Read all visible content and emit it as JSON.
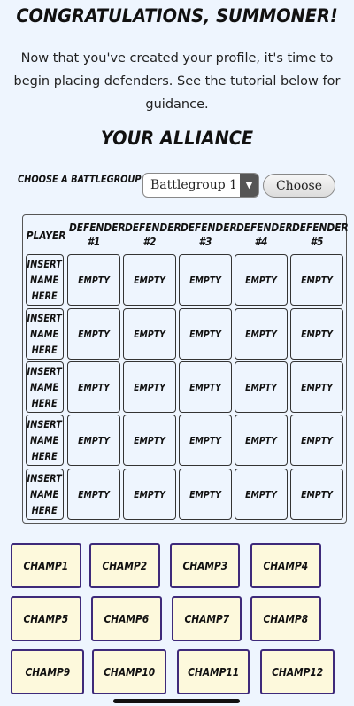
{
  "header": {
    "title": "CONGRATULATIONS, SUMMONER!",
    "intro": "Now that you've created your profile, it's time to begin placing defenders. See the tutorial below for guidance."
  },
  "alliance": {
    "title": "YOUR ALLIANCE",
    "battlegroup_label": "CHOOSE A BATTLEGROUP:",
    "battlegroup_selected": "Battlegroup 1",
    "choose_label": "Choose"
  },
  "table": {
    "player_header": "PLAYER",
    "defender_headers": [
      [
        "DEFENDER",
        "#1"
      ],
      [
        "DEFENDER",
        "#2"
      ],
      [
        "DEFENDER",
        "#3"
      ],
      [
        "DEFENDER",
        "#4"
      ],
      [
        "DEFENDER",
        "#5"
      ]
    ],
    "rows": [
      {
        "player": [
          "INSERT",
          "NAME",
          "HERE"
        ],
        "slots": [
          "EMPTY",
          "EMPTY",
          "EMPTY",
          "EMPTY",
          "EMPTY"
        ]
      },
      {
        "player": [
          "INSERT",
          "NAME",
          "HERE"
        ],
        "slots": [
          "EMPTY",
          "EMPTY",
          "EMPTY",
          "EMPTY",
          "EMPTY"
        ]
      },
      {
        "player": [
          "INSERT",
          "NAME",
          "HERE"
        ],
        "slots": [
          "EMPTY",
          "EMPTY",
          "EMPTY",
          "EMPTY",
          "EMPTY"
        ]
      },
      {
        "player": [
          "INSERT",
          "NAME",
          "HERE"
        ],
        "slots": [
          "EMPTY",
          "EMPTY",
          "EMPTY",
          "EMPTY",
          "EMPTY"
        ]
      },
      {
        "player": [
          "INSERT",
          "NAME",
          "HERE"
        ],
        "slots": [
          "EMPTY",
          "EMPTY",
          "EMPTY",
          "EMPTY",
          "EMPTY"
        ]
      }
    ]
  },
  "champions": [
    "CHAMP1",
    "CHAMP2",
    "CHAMP3",
    "CHAMP4",
    "CHAMP5",
    "CHAMP6",
    "CHAMP7",
    "CHAMP8",
    "CHAMP9",
    "CHAMP10",
    "CHAMP11",
    "CHAMP12"
  ],
  "colors": {
    "background": "#eef5fe",
    "champ_fill": "#fdf9dc",
    "champ_border": "#3e2a7a"
  }
}
